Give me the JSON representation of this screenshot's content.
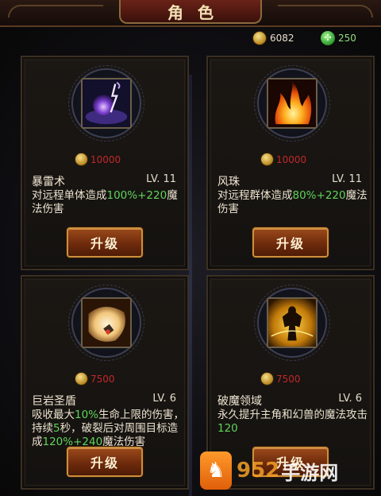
{
  "header": {
    "title": "角色"
  },
  "currency": {
    "coins": "6082",
    "gems": "250"
  },
  "skills": [
    {
      "name": "暴雷术",
      "level": "LV. 11",
      "cost": "10000",
      "desc_pre": "对远程单体造成",
      "desc_hl": "100%+220",
      "desc_post": "魔法伤害",
      "icon": "lightning-orb-icon",
      "button": "升级"
    },
    {
      "name": "风珠",
      "level": "LV. 11",
      "cost": "10000",
      "desc_pre": "对远程群体造成",
      "desc_hl": "80%+220",
      "desc_post": "魔法伤害",
      "icon": "flame-icon",
      "button": "升级"
    },
    {
      "name": "巨岩圣盾",
      "level": "LV. 6",
      "cost": "7500",
      "desc_a": "吸收最大",
      "desc_hl1": "10%",
      "desc_b": "生命上限的伤害，持续",
      "desc_hl2": "5",
      "desc_c": "秒，破裂后对周围目标造成",
      "desc_hl3": "120%+240",
      "desc_d": "魔法伤害",
      "icon": "rock-shield-icon",
      "button": "升级"
    },
    {
      "name": "破魔领域",
      "level": "LV. 6",
      "cost": "7500",
      "desc_a": "永久提升主角和幻兽的魔法攻击",
      "desc_hl1": "120",
      "icon": "magic-domain-icon",
      "button": "升级"
    }
  ],
  "watermark": {
    "number": "952",
    "label": "手游网"
  },
  "colors": {
    "highlight": "#5fd45a",
    "cost": "#c0282a",
    "accent": "#c9913d"
  }
}
